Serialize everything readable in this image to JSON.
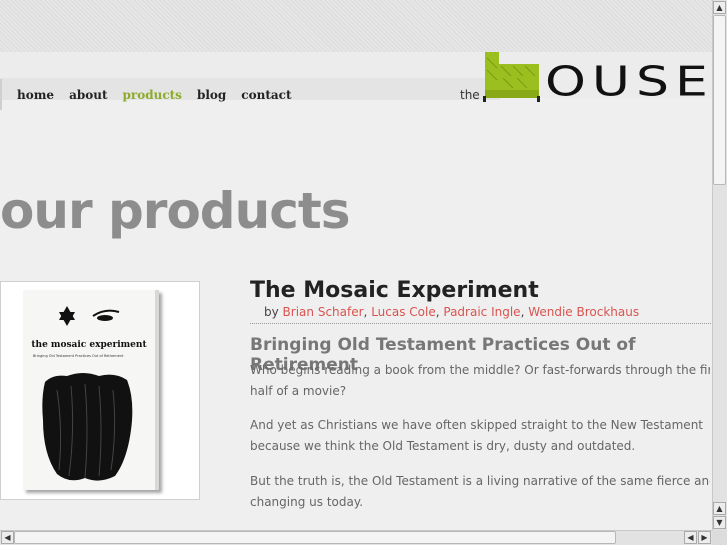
{
  "nav": {
    "items": [
      {
        "label": "home",
        "active": false
      },
      {
        "label": "about",
        "active": false
      },
      {
        "label": "products",
        "active": true
      },
      {
        "label": "blog",
        "active": false
      },
      {
        "label": "contact",
        "active": false
      }
    ]
  },
  "logo": {
    "prefix": "the",
    "word": "OUSE",
    "accent_color": "#9bbf1f"
  },
  "page": {
    "title": "our products"
  },
  "product": {
    "title": "The Mosaic Experiment",
    "by_label": "by",
    "authors": [
      "Brian Schafer",
      "Lucas Cole",
      "Padraic Ingle",
      "Wendie Brockhaus"
    ],
    "subtitle": "Bringing Old Testament Practices Out of Retirement",
    "paragraphs": [
      "Who begins reading a book from the middle? Or fast-forwards through the first",
      "half of a movie?",
      "And yet as Christians we have often skipped straight to the New Testament",
      "because we think the Old Testament is dry, dusty and outdated.",
      "But the truth is, the Old Testament is a living narrative of the same fierce and hol",
      "changing us today."
    ],
    "cover": {
      "title": "the mosaic experiment",
      "subtitle": "Bringing Old Testament Practices Out of Retirement"
    }
  },
  "colors": {
    "nav_active": "#8caa2c",
    "author_link": "#d9534f",
    "title_gray": "#8d8d8d"
  }
}
